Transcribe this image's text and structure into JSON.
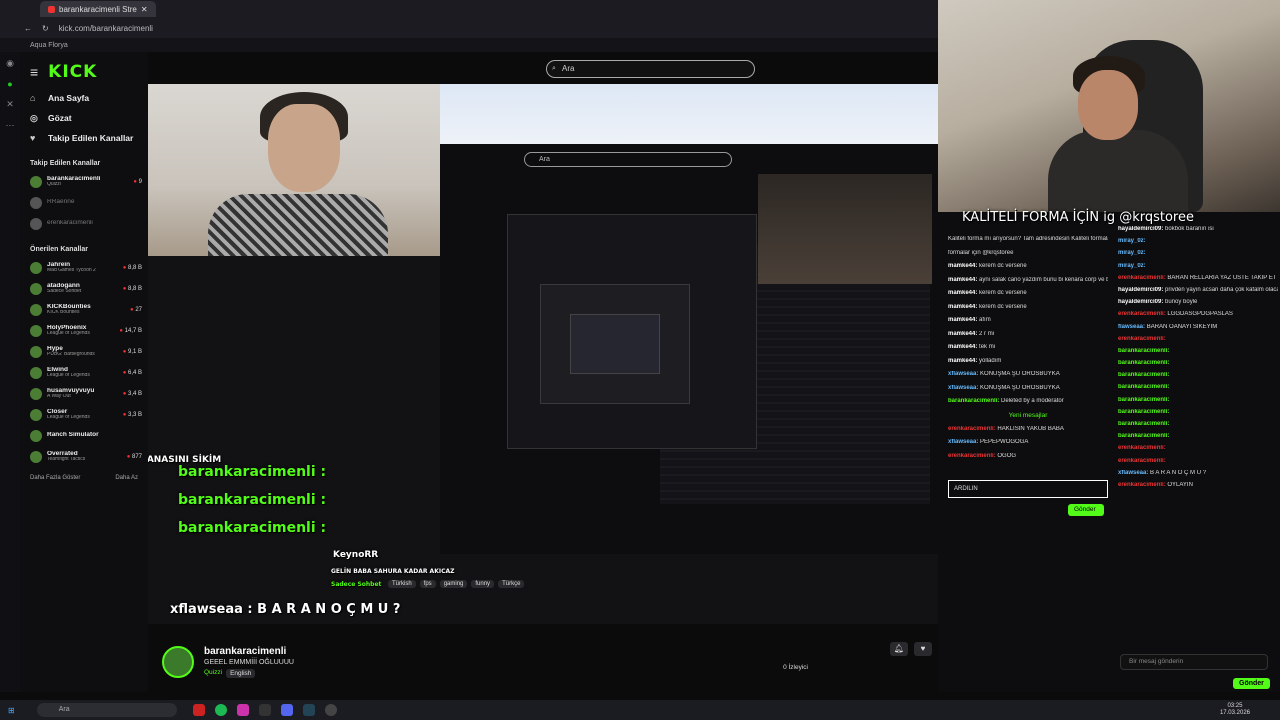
{
  "browser": {
    "tab_title": "barankaracimenli Stre",
    "url": "kick.com/barankaracimenli",
    "bookmark": "Aqua Florya"
  },
  "brand": {
    "logo": "KICK",
    "accent": "#53fc18"
  },
  "search": {
    "placeholder": "Ara"
  },
  "nav": [
    {
      "label": "Ana Sayfa",
      "icon": "home-icon"
    },
    {
      "label": "Gözat",
      "icon": "browse-icon"
    },
    {
      "label": "Takip Edilen Kanallar",
      "icon": "heart-icon"
    }
  ],
  "followed": {
    "title": "Takip Edilen Kanallar",
    "items": [
      {
        "name": "barankaracimenli",
        "sub": "Quizzi",
        "viewers": "9",
        "live": true
      },
      {
        "name": "RRaenne",
        "sub": "",
        "viewers": "",
        "live": false
      },
      {
        "name": "erenkaracimenli",
        "sub": "",
        "viewers": "",
        "live": false
      }
    ]
  },
  "recommended": {
    "title": "Önerilen Kanallar",
    "items": [
      {
        "name": "Jahrein",
        "sub": "Mad Games Tycoon 2",
        "viewers": "8,8 B"
      },
      {
        "name": "atadogann",
        "sub": "Sadece Sohbet",
        "viewers": "8,8 B"
      },
      {
        "name": "KICKBounties",
        "sub": "KICK Bounties",
        "viewers": "27"
      },
      {
        "name": "HolyPhoenix",
        "sub": "League of Legends",
        "viewers": "14,7 B"
      },
      {
        "name": "Hype",
        "sub": "PUBG: Battlegrounds",
        "viewers": "9,1 B"
      },
      {
        "name": "Elwind",
        "sub": "League of Legends",
        "viewers": "6,4 B"
      },
      {
        "name": "husamvuyvuyu",
        "sub": "A Way Out",
        "viewers": "3,4 B"
      },
      {
        "name": "Closer",
        "sub": "League of Legends",
        "viewers": "3,3 B"
      },
      {
        "name": "Ranch Simulator",
        "sub": "",
        "viewers": ""
      },
      {
        "name": "Overrated",
        "sub": "Teamfight Tactics",
        "viewers": "877"
      }
    ],
    "more": "Daha Fazla Göster",
    "less": "Daha Az"
  },
  "overlay": {
    "caption1": "barankaracimenli : ARDILIN ANASINI SİKİM",
    "caption2": "barankaracimenli :",
    "caption3": "xflawseaa : B A R A N O Ç M U ?",
    "inner_channel": "KeynoRR",
    "inner_title": "GELİN BABA SAHURA KADAR AKICAZ",
    "inner_cat": "Sadece Sohbet",
    "inner_tags": [
      "Türkish",
      "fps",
      "gaming",
      "funny",
      "Türkçe"
    ]
  },
  "stream": {
    "channel": "barankaracimenli",
    "title": "GEEEL EMMMİİİ OĞLUUUU",
    "category": "Quizzi",
    "language": "English",
    "viewers": "0 İzleyici"
  },
  "webcam_title": "KALİTELİ FORMA İÇİN ig @krqstoree",
  "inner_chat": [
    {
      "u": "",
      "m": "Kaliteli forma mı arıyorsun? Tam adresindesin Kaliteli formalar için..."
    },
    {
      "u": "",
      "m": "formalar için @krqstoree"
    },
    {
      "u": "mamke44",
      "m": "kerem dc versene"
    },
    {
      "u": "mamke44",
      "m": "aynı salak cano yazdım bunu bi kenara corp ve black"
    },
    {
      "u": "mamke44",
      "m": "kerem dc versene"
    },
    {
      "u": "mamke44",
      "m": "kerem dc versene"
    },
    {
      "u": "mamke44",
      "m": "afım"
    },
    {
      "u": "mamke44",
      "m": "2 r mi"
    },
    {
      "u": "mamke44",
      "m": "tek mi"
    },
    {
      "u": "mamke44",
      "m": "yolladım"
    },
    {
      "u": "xflawseaa",
      "m": "KONUŞMA ŞU OROSBUYKA"
    },
    {
      "u": "xflawseaa",
      "m": "KONUŞMA ŞU OROSBUYKA"
    },
    {
      "u": "barankaracimenli",
      "m": "Deleted by a moderator"
    }
  ],
  "inner_new": "Yeni mesajlar",
  "inner_chat2": [
    {
      "u": "erenkaracimenli",
      "m": "HAKLISIN YAKUB BABA"
    },
    {
      "u": "xflawseaa",
      "m": "PEPEPWÖĞÖĞA"
    },
    {
      "u": "erenkaracimenli",
      "m": "ÖĞÖĞ"
    }
  ],
  "inner_input": "ARDILIN",
  "inner_send": "Gönder",
  "chat": [
    {
      "u": "hayaldemirci09",
      "m": "bokbok baranın isi"
    },
    {
      "u": "miray_0z",
      "m": ""
    },
    {
      "u": "miray_0z",
      "m": ""
    },
    {
      "u": "miray_0z",
      "m": ""
    },
    {
      "u": "erenkaracimenli",
      "m": "BARAN RELLARİA YAZ ÜSTE TAKİP ET"
    },
    {
      "u": "hayaldemirci09",
      "m": "privden yayın acsan daha çok kafalm olacak baran"
    },
    {
      "u": "hayaldemirci09",
      "m": "bunoy boyle"
    },
    {
      "u": "erenkaracimenli",
      "m": "LGGDASGPDGPASLAS"
    },
    {
      "u": "flawseaa",
      "m": "BARAN OANAYI SİKEYİM"
    },
    {
      "u": "erenkaracimenli",
      "m": ""
    },
    {
      "u": "barankaracimenli",
      "m": ""
    },
    {
      "u": "barankaracimenli",
      "m": ""
    },
    {
      "u": "barankaracimenli",
      "m": ""
    },
    {
      "u": "barankaracimenli",
      "m": ""
    },
    {
      "u": "barankaracimenli",
      "m": ""
    },
    {
      "u": "barankaracimenli",
      "m": ""
    },
    {
      "u": "barankaracimenli",
      "m": ""
    },
    {
      "u": "barankaracimenli",
      "m": ""
    },
    {
      "u": "erenkaracimenli",
      "m": ""
    },
    {
      "u": "erenkaracimenli",
      "m": ""
    },
    {
      "u": "xflawseaa",
      "m": "B A R A N O Ç M U ?"
    },
    {
      "u": "erenkaracimenli",
      "m": "OYLAYIN"
    }
  ],
  "chat_input": "Bir mesaj gönderin",
  "chat_send": "Gönder",
  "taskbar": {
    "search": "Ara",
    "time": "03:25",
    "date": "17.03.2026"
  }
}
